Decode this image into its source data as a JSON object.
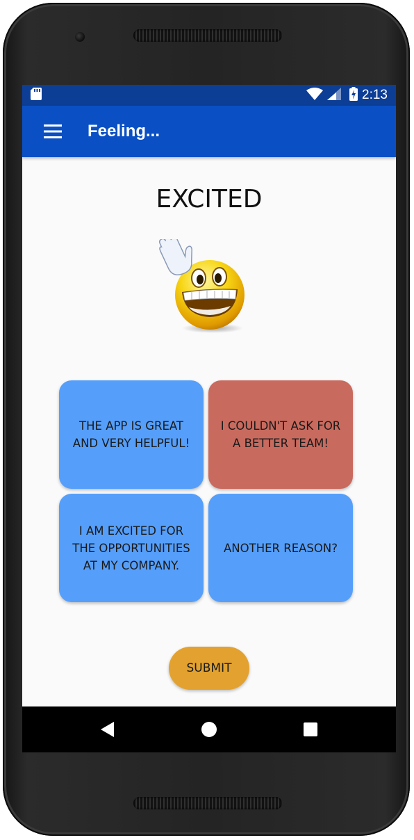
{
  "status_bar": {
    "time": "2:13",
    "icons": [
      "sd-card-icon",
      "wifi-icon",
      "cell-signal-icon",
      "battery-charging-icon"
    ]
  },
  "app_bar": {
    "title": "Feeling...",
    "menu_icon": "hamburger-menu-icon"
  },
  "mood": {
    "title": "EXCITED",
    "emoji": "excited-waving-smiley"
  },
  "reasons": [
    {
      "label": "THE APP IS GREAT AND VERY HELPFUL!",
      "color": "#559ffb",
      "selected": false
    },
    {
      "label": "I COULDN'T ASK FOR A BETTER TEAM!",
      "color": "#c96a5e",
      "selected": true
    },
    {
      "label": "I AM EXCITED FOR THE OPPORTUNITIES AT MY COMPANY.",
      "color": "#559ffb",
      "selected": false
    },
    {
      "label": "ANOTHER REASON?",
      "color": "#559ffb",
      "selected": false
    }
  ],
  "submit_label": "SUBMIT",
  "colors": {
    "status_bar": "#0d3e96",
    "app_bar": "#0a50c4",
    "reason_default": "#559ffb",
    "reason_selected": "#c96a5e",
    "submit": "#e3a22f"
  },
  "nav_bar": [
    "back-icon",
    "home-icon",
    "recents-icon"
  ]
}
